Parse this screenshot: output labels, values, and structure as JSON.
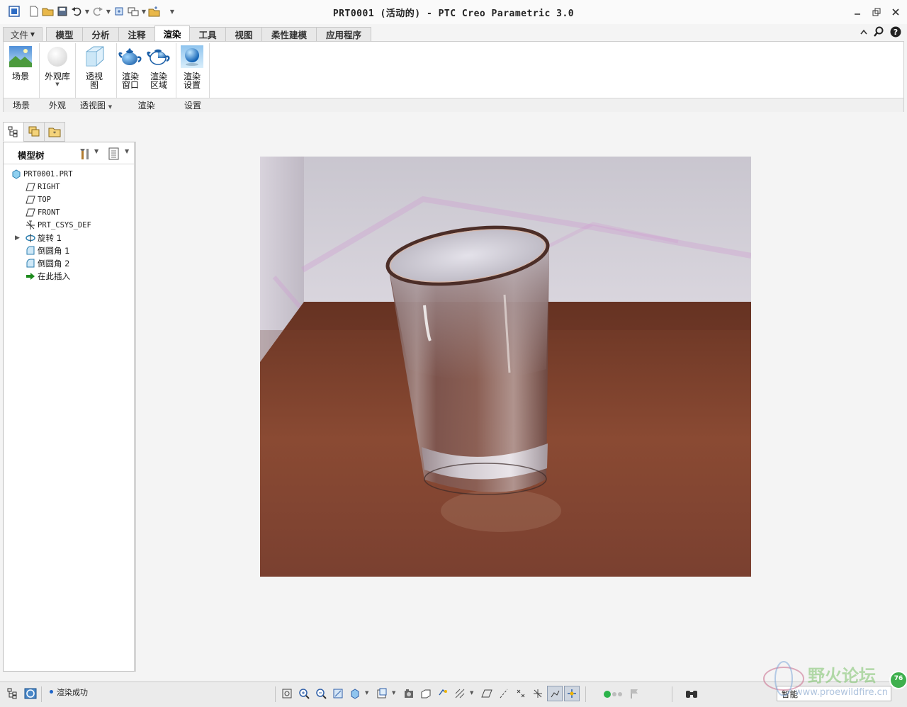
{
  "window": {
    "title": "PRT0001 (活动的) - PTC Creo Parametric 3.0"
  },
  "ribbon": {
    "tabs": [
      {
        "label": "文件"
      },
      {
        "label": "模型"
      },
      {
        "label": "分析"
      },
      {
        "label": "注释"
      },
      {
        "label": "渲染"
      },
      {
        "label": "工具"
      },
      {
        "label": "视图"
      },
      {
        "label": "柔性建模"
      },
      {
        "label": "应用程序"
      }
    ],
    "active_tab": "渲染",
    "buttons": {
      "scene": "场景",
      "appearance_lib": "外观库",
      "perspective_l1": "透视",
      "perspective_l2": "图",
      "render_window_l1": "渲染",
      "render_window_l2": "窗口",
      "render_region_l1": "渲染",
      "render_region_l2": "区域",
      "render_settings_l1": "渲染",
      "render_settings_l2": "设置"
    },
    "groups": {
      "scene": "场景",
      "appearance": "外观",
      "perspective": "透视图",
      "render": "渲染",
      "settings": "设置"
    }
  },
  "model_tree": {
    "title": "模型树",
    "items": [
      {
        "label": "PRT0001.PRT",
        "icon": "part-icon"
      },
      {
        "label": "RIGHT",
        "icon": "datum-plane-icon"
      },
      {
        "label": "TOP",
        "icon": "datum-plane-icon"
      },
      {
        "label": "FRONT",
        "icon": "datum-plane-icon"
      },
      {
        "label": "PRT_CSYS_DEF",
        "icon": "coordinate-system-icon"
      },
      {
        "label": "旋转 1",
        "icon": "revolve-icon"
      },
      {
        "label": "倒圆角 1",
        "icon": "round-icon"
      },
      {
        "label": "倒圆角 2",
        "icon": "round-icon"
      },
      {
        "label": "在此插入",
        "icon": "insert-here-arrow-icon"
      }
    ]
  },
  "status": {
    "message": "渲染成功",
    "filter": "智能"
  },
  "watermark": {
    "text": "野火论坛",
    "url": "www.proewildfire.cn",
    "badge": "76"
  },
  "colors": {
    "accent": "#1e64c8",
    "status_green": "#2bb34a",
    "tab_text": "#333333"
  }
}
